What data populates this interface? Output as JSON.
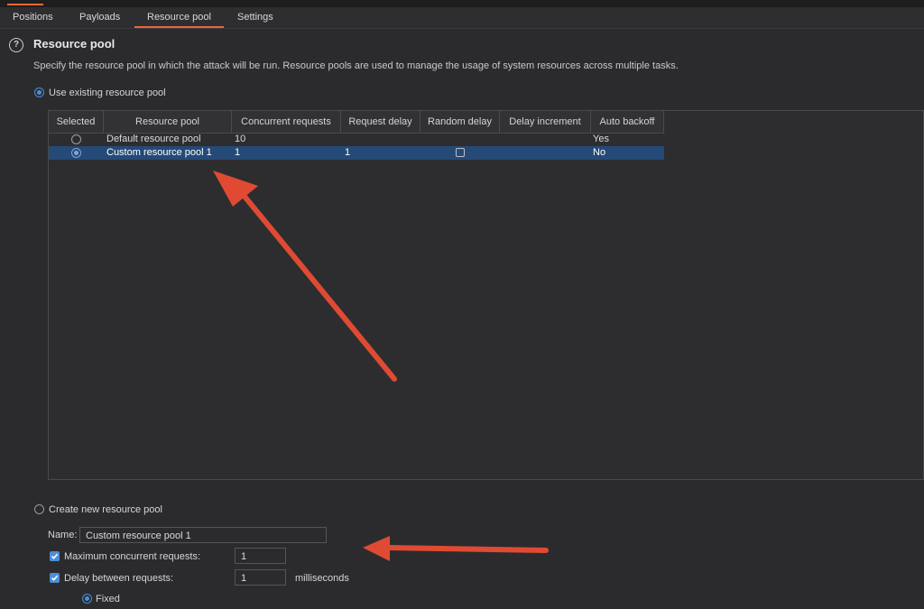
{
  "tabs": [
    {
      "label": "Positions",
      "active": false
    },
    {
      "label": "Payloads",
      "active": false
    },
    {
      "label": "Resource pool",
      "active": true
    },
    {
      "label": "Settings",
      "active": false
    }
  ],
  "section": {
    "title": "Resource pool",
    "description": "Specify the resource pool in which the attack will be run. Resource pools are used to manage the usage of system resources across multiple tasks."
  },
  "use_existing": {
    "label": "Use existing resource pool",
    "selected": true
  },
  "table": {
    "headers": [
      "Selected",
      "Resource pool",
      "Concurrent requests",
      "Request delay",
      "Random delay",
      "Delay increment",
      "Auto backoff"
    ],
    "rows": [
      {
        "resource_pool": "Default resource pool",
        "concurrent_requests": "10",
        "request_delay": "",
        "random_delay": false,
        "delay_increment": "",
        "auto_backoff": "Yes",
        "selected": false
      },
      {
        "resource_pool": "Custom resource pool 1",
        "concurrent_requests": "1",
        "request_delay": "1",
        "random_delay": false,
        "delay_increment": "",
        "auto_backoff": "No",
        "selected": true
      }
    ]
  },
  "create_new": {
    "label": "Create new resource pool",
    "selected": false,
    "name_label": "Name:",
    "name_value": "Custom resource pool 1",
    "max_concurrent_label": "Maximum concurrent requests:",
    "max_concurrent_checked": true,
    "max_concurrent_value": "1",
    "delay_label": "Delay between requests:",
    "delay_checked": true,
    "delay_value": "1",
    "delay_unit": "milliseconds",
    "fixed_label": "Fixed",
    "fixed_selected": true
  },
  "colors": {
    "accent": "#e6693b",
    "selection": "#254a78",
    "annotation_arrow": "#e04a33"
  },
  "annotation_arrows": [
    {
      "name": "arrow-to-custom-pool-row",
      "points_at": "Custom resource pool 1 row"
    },
    {
      "name": "arrow-to-create-new-settings",
      "points_at": "Create new resource pool settings"
    }
  ]
}
